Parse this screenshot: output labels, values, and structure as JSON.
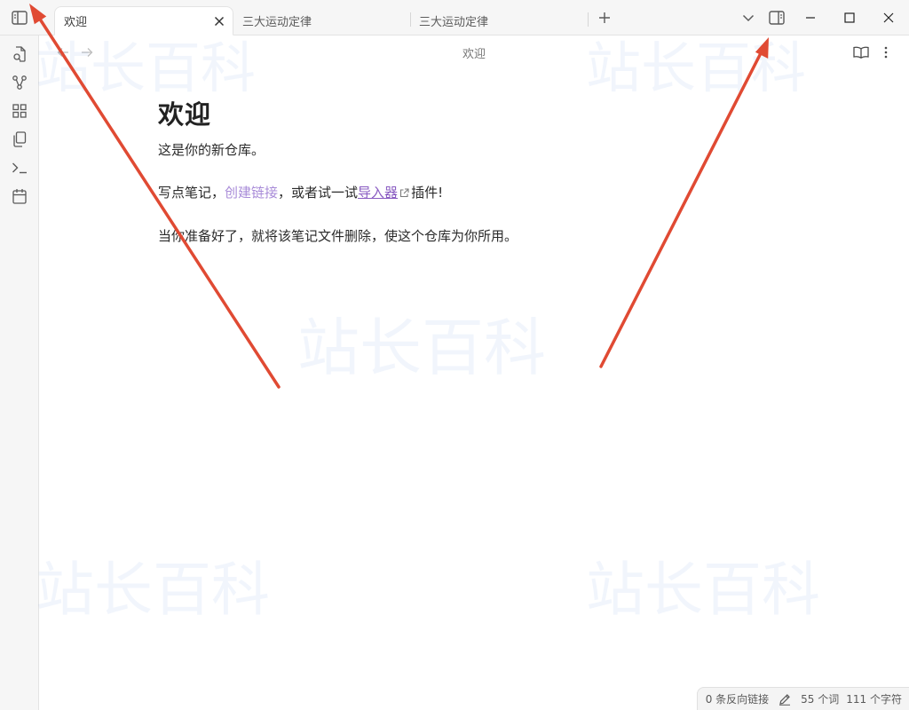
{
  "colors": {
    "tabbar_bg": "#f6f6f6",
    "link_internal": "#a88bd8",
    "link_external": "#8a5cc2",
    "arrow": "#e04a33"
  },
  "tabs": [
    {
      "label": "欢迎",
      "active": true
    },
    {
      "label": "三大运动定律",
      "active": false
    },
    {
      "label": "三大运动定律",
      "active": false
    }
  ],
  "icons": {
    "left_sidebar_toggle": "sidebar-left-icon",
    "new_tab": "plus-icon",
    "tab_list": "chevron-down-icon",
    "right_sidebar_toggle": "sidebar-right-icon",
    "minimize": "minimize-icon",
    "maximize": "maximize-icon",
    "close": "close-icon",
    "ribbon": [
      "open-note-icon",
      "graph-view-icon",
      "canvas-icon",
      "templates-icon",
      "command-palette-icon",
      "daily-note-icon"
    ],
    "back": "arrow-left-icon",
    "forward": "arrow-right-icon",
    "reading_view": "book-open-icon",
    "more_options": "more-vertical-icon",
    "external_link": "external-link-icon",
    "edit_mode": "pencil-icon"
  },
  "view": {
    "title": "欢迎"
  },
  "note": {
    "heading": "欢迎",
    "p1": "这是你的新仓库。",
    "p2_before": "写点笔记，",
    "p2_link": "创建链接",
    "p2_middle": "，或者试一试",
    "p2_ext_link": "导入器",
    "p2_after": "插件!",
    "p3": "当你准备好了，就将该笔记文件删除，使这个仓库为你所用。"
  },
  "watermark": {
    "text": "站长百科"
  },
  "status": {
    "backlinks": "0 条反向链接",
    "words": "55 个词",
    "chars": "111 个字符"
  }
}
